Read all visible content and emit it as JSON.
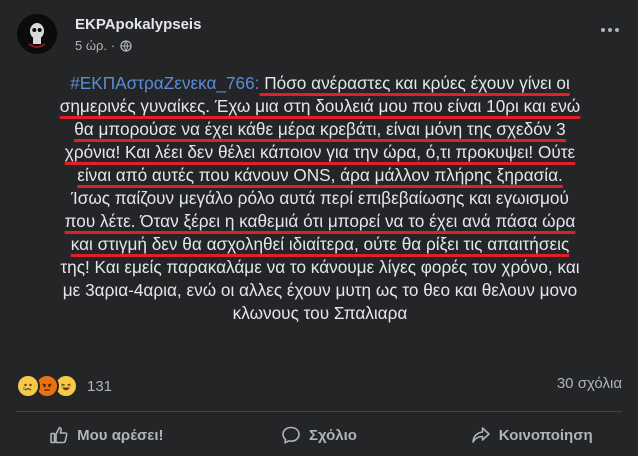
{
  "post": {
    "author": "EKPApokalypseis",
    "time": "5 ώρ. ·",
    "privacy_icon": "globe-icon",
    "hashtag": "#ΕΚΠΑστραΖενεκα_766:",
    "lines": [
      " Πόσο ανέραστες και κρύες έχουν γίνει οι",
      "σημερινές γυναίκες. Έχω μια στη δουλειά μου που είναι 10ρι και ενώ",
      "θα μπορούσε να έχει κάθε μέρα κρεβάτι, είναι μόνη της σχεδόν 3",
      "χρόνια! Και λέει δεν θέλει κάποιον για την ώρα, ό,τι προκυψει! Ούτε",
      "είναι από αυτές που κάνουν ONS, άρα μάλλον πλήρης ξηρασία.",
      "Ίσως παίζουν μεγάλο ρόλο αυτά περί επιβεβαίωσης και εγωισμού",
      "που λέτε. Όταν ξέρει η καθεμιά ότι μπορεί να το έχει ανά πάσα ώρα",
      "και στιγμή δεν θα ασχοληθεί ιδιαίτερα, ούτε θα ρίξει τις απαιτήσεις",
      "της! Και εμείς παρακαλάμε να το κάνουμε λίγες φορές τον χρόνο, και",
      "με 3αρια-4αρια, ενώ οι αλλες έχουν μυτη ως το θεο και θελουν μονο",
      "κλωνους του Σπαλιαρα"
    ]
  },
  "reactions": {
    "icons": [
      "sad-face-icon",
      "angry-face-icon",
      "laughing-face-icon"
    ],
    "count": "131",
    "comments": "30 σχόλια"
  },
  "actions": {
    "like": "Μου αρέσει!",
    "comment": "Σχόλιο",
    "share": "Κοινοποίηση"
  },
  "colors": {
    "background": "#242526",
    "text": "#e4e6eb",
    "muted": "#b0b3b8",
    "hashtag": "#5b8dd9",
    "underline": "#e41e26"
  }
}
